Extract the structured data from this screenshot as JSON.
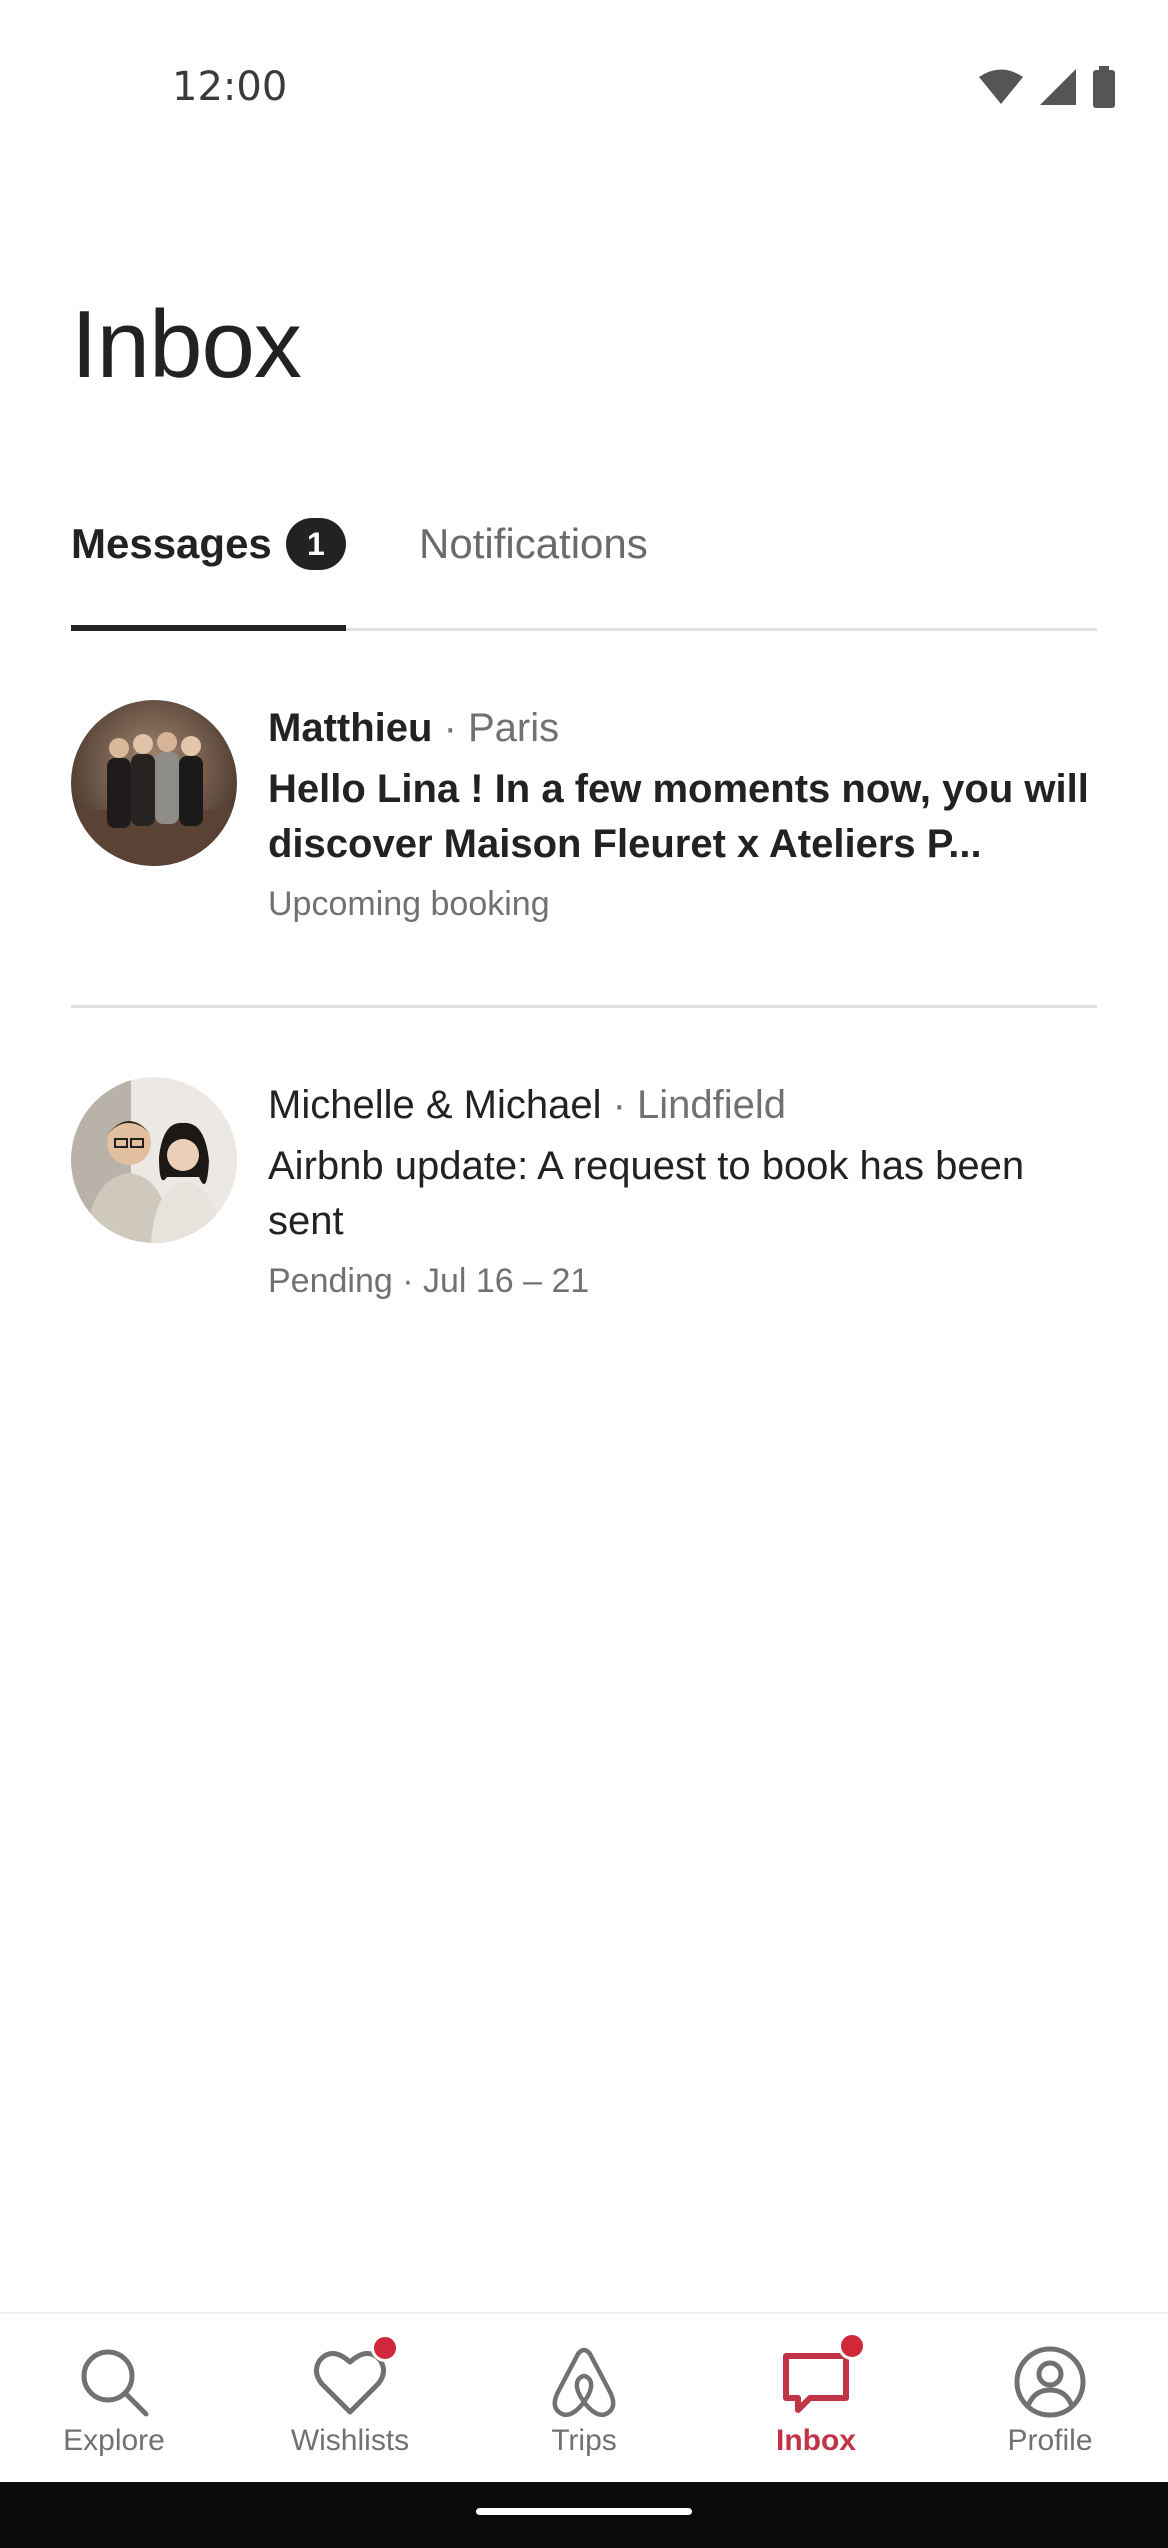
{
  "status_bar": {
    "time": "12:00",
    "icons": [
      "wifi-icon",
      "cellular-signal-icon",
      "battery-icon"
    ]
  },
  "page": {
    "title": "Inbox"
  },
  "tabs": [
    {
      "label": "Messages",
      "badge": "1",
      "active": true
    },
    {
      "label": "Notifications",
      "active": false
    }
  ],
  "threads": [
    {
      "sender": "Matthieu",
      "location": "· Paris",
      "snippet": "Hello Lina !  In a few moments now, you will discover Maison Fleuret x Ateliers P...",
      "meta": "Upcoming booking",
      "unread": true
    },
    {
      "sender": "Michelle & Michael",
      "location": "· Lindfield",
      "snippet": "Airbnb update: A request to book has been sent",
      "meta": "Pending · Jul 16 – 21",
      "unread": false
    }
  ],
  "bottom_nav": [
    {
      "label": "Explore",
      "icon": "search-icon",
      "active": false,
      "dot": false
    },
    {
      "label": "Wishlists",
      "icon": "heart-icon",
      "active": false,
      "dot": true
    },
    {
      "label": "Trips",
      "icon": "airbnb-logo-icon",
      "active": false,
      "dot": false
    },
    {
      "label": "Inbox",
      "icon": "message-icon",
      "active": true,
      "dot": true
    },
    {
      "label": "Profile",
      "icon": "profile-icon",
      "active": false,
      "dot": false
    }
  ],
  "colors": {
    "accent": "#c13347",
    "notification_dot": "#d0283a",
    "text_primary": "#222222",
    "text_secondary": "#717171"
  }
}
